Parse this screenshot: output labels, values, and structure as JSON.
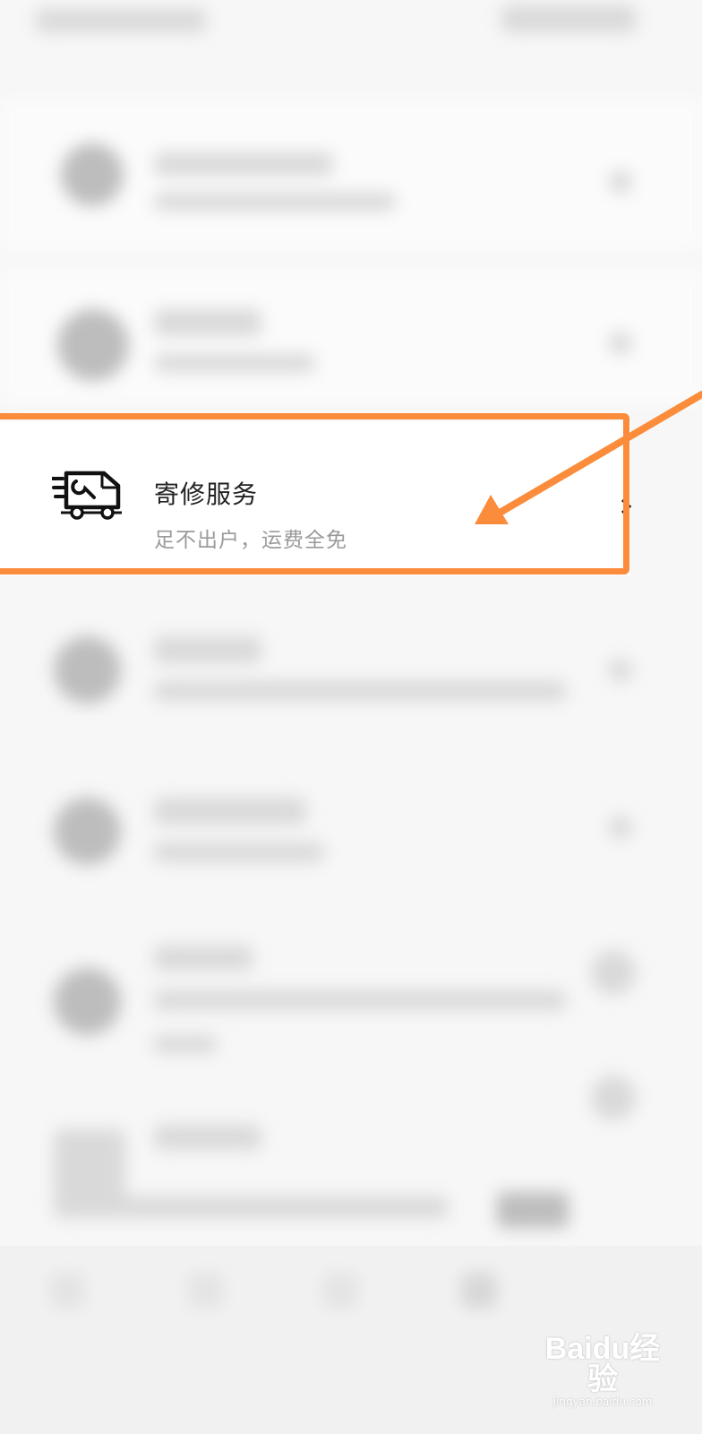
{
  "service": {
    "title": "寄修服务",
    "subtitle": "足不出户，运费全免",
    "icon": "repair-van-icon"
  },
  "watermark": {
    "brand": "Baidu经验",
    "url": "jingyan.baidu.com"
  },
  "colors": {
    "highlight": "#fb8c3c",
    "background": "#f7f7f7",
    "subtitle": "#9a9a9a"
  }
}
